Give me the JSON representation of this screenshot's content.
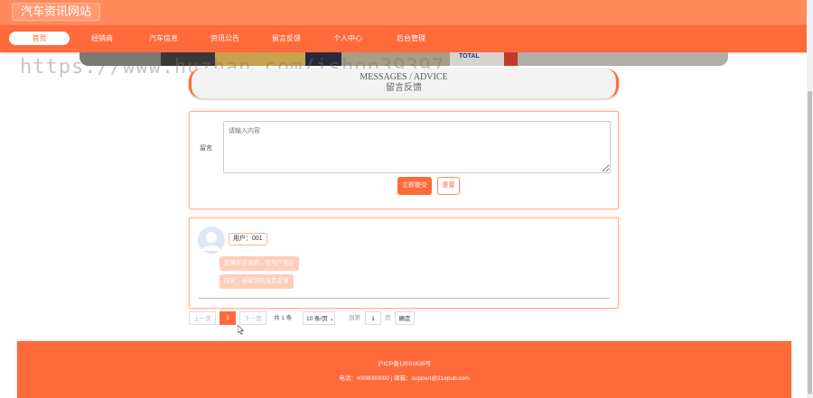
{
  "header": {
    "site_title": "汽车资讯网站"
  },
  "nav": {
    "items": [
      {
        "label": "首页",
        "active": true
      },
      {
        "label": "经销商"
      },
      {
        "label": "汽车信息"
      },
      {
        "label": "资讯公告"
      },
      {
        "label": "留言反馈"
      },
      {
        "label": "个人中心"
      },
      {
        "label": "后台管理"
      }
    ]
  },
  "banner": {
    "sponsor_text": "TOTAL"
  },
  "watermark": "https://www.huzhan.com/ishop39397",
  "section": {
    "title_en": "MESSAGES / ADVICE",
    "title_cn": "留言反馈"
  },
  "form": {
    "label": "留言",
    "placeholder": "请输入内容",
    "submit_label": "立即提交",
    "reset_label": "重置"
  },
  "comments": [
    {
      "user": "用户：001",
      "message": "这辆车还蛮好，受用户欢迎",
      "reply": "回复：感谢您的宝贵反馈"
    }
  ],
  "pagination": {
    "prev_label": "上一页",
    "current_page": "1",
    "next_label": "下一页",
    "total_text": "共 1 条",
    "page_size": "10 条/页",
    "goto_label": "到第",
    "goto_value": "1",
    "page_unit": "页",
    "confirm_label": "确定"
  },
  "footer": {
    "icp": "沪ICP备13031638号",
    "contact": "电话：4008000000 | 邮箱：support@21epub.com"
  },
  "colors": {
    "accent": "#ff6a3a",
    "topbar": "#ff8a5c",
    "chip": "#ffcdb8"
  }
}
